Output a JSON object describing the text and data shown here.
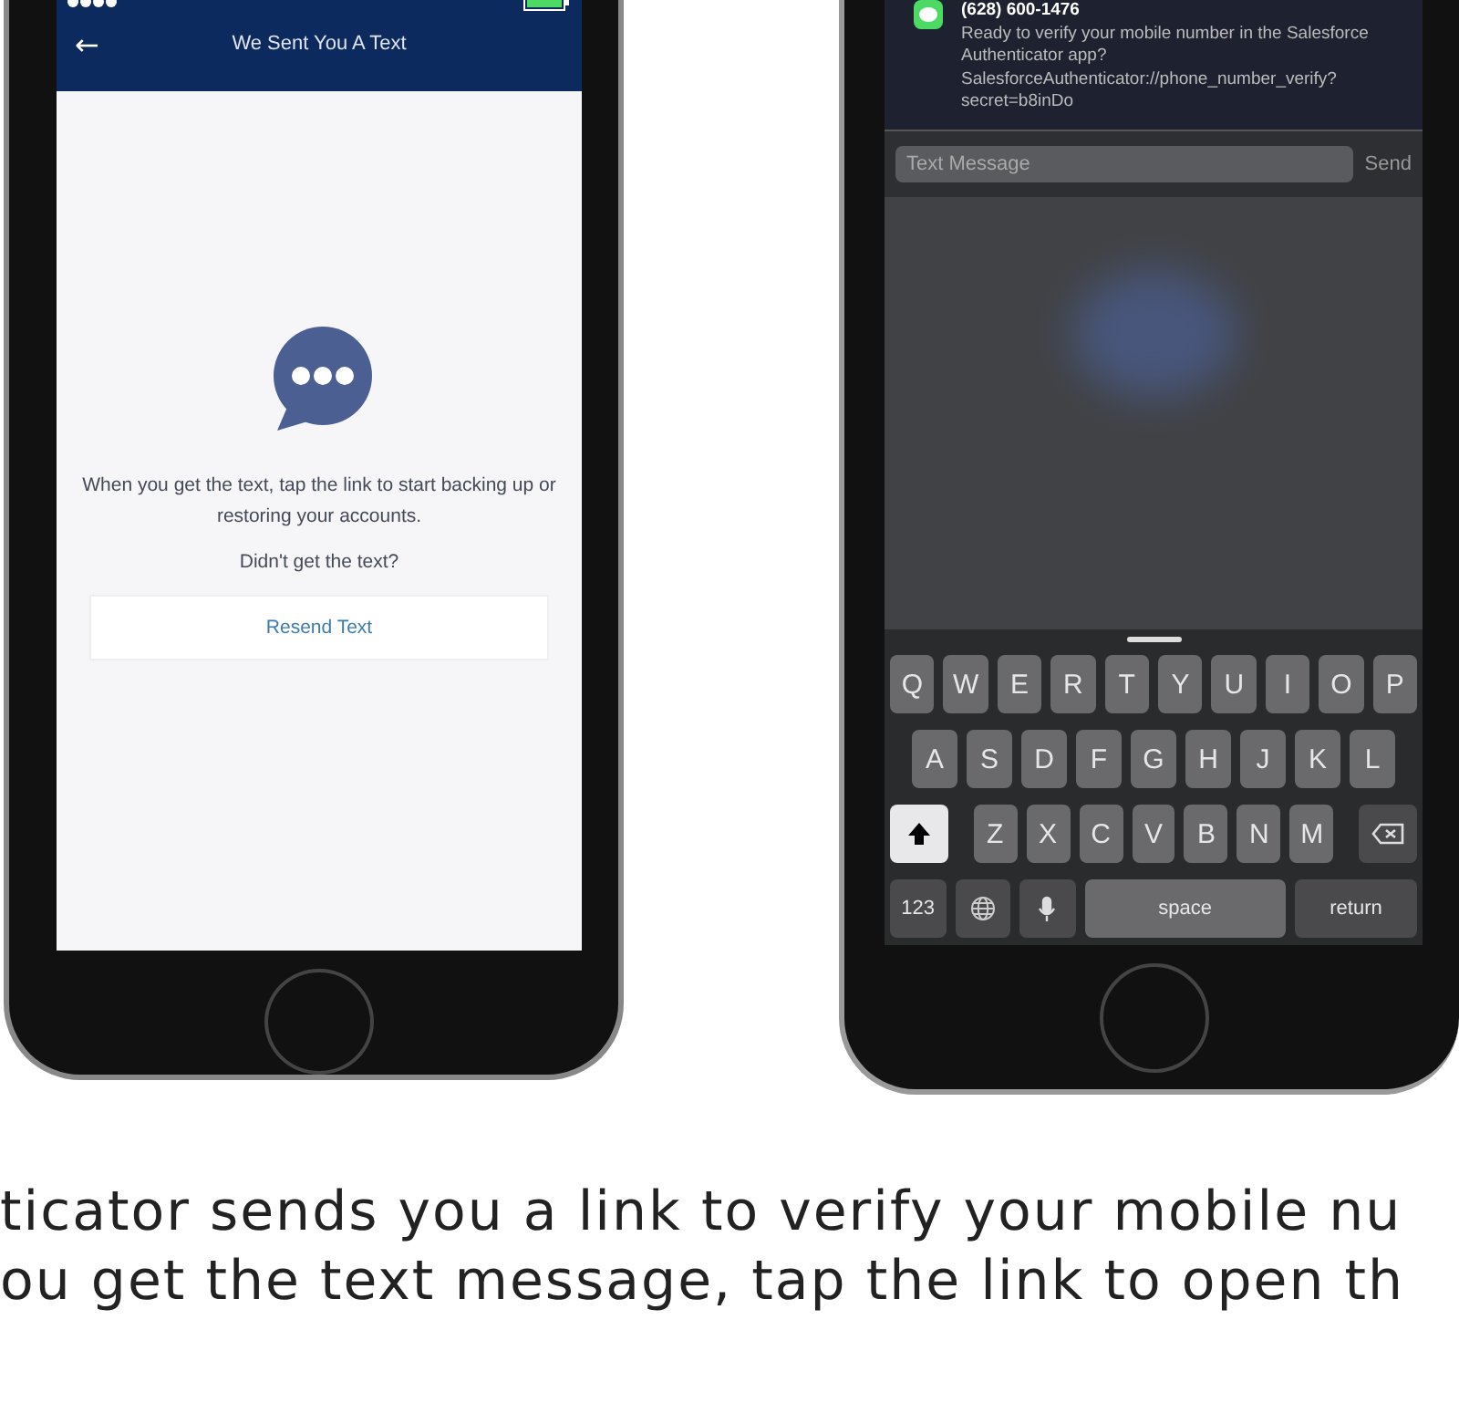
{
  "left_phone": {
    "nav_bar": {
      "back": "←",
      "title": "We Sent You A Text"
    },
    "message": "When you get the text, tap the link to start backing up or restoring your accounts.",
    "prompt": "Didn't get the text?",
    "button": "Resend Text"
  },
  "right_phone": {
    "notification": {
      "sender": "(628) 600-1476",
      "body": "Ready to verify your mobile number in the Salesforce Authenticator app? SalesforceAuthenticator://phone_number_verify?secret=b8inDo"
    },
    "reply": {
      "placeholder": "Text Message",
      "send": "Send"
    },
    "keyboard": [
      [
        {
          "kind": "letter",
          "label": "Q"
        },
        {
          "kind": "letter",
          "label": "W"
        },
        {
          "kind": "letter",
          "label": "E"
        },
        {
          "kind": "letter",
          "label": "R"
        },
        {
          "kind": "letter",
          "label": "T"
        },
        {
          "kind": "letter",
          "label": "Y"
        },
        {
          "kind": "letter",
          "label": "U"
        },
        {
          "kind": "letter",
          "label": "I"
        },
        {
          "kind": "letter",
          "label": "O"
        },
        {
          "kind": "letter",
          "label": "P"
        }
      ],
      [
        {
          "kind": "letter",
          "label": "A"
        },
        {
          "kind": "letter",
          "label": "S"
        },
        {
          "kind": "letter",
          "label": "D"
        },
        {
          "kind": "letter",
          "label": "F"
        },
        {
          "kind": "letter",
          "label": "G"
        },
        {
          "kind": "letter",
          "label": "H"
        },
        {
          "kind": "letter",
          "label": "J"
        },
        {
          "kind": "letter",
          "label": "K"
        },
        {
          "kind": "letter",
          "label": "L"
        }
      ],
      [
        {
          "kind": "shift",
          "on": true
        },
        {
          "kind": "letter",
          "label": "Z"
        },
        {
          "kind": "letter",
          "label": "X"
        },
        {
          "kind": "letter",
          "label": "C"
        },
        {
          "kind": "letter",
          "label": "V"
        },
        {
          "kind": "letter",
          "label": "B"
        },
        {
          "kind": "letter",
          "label": "N"
        },
        {
          "kind": "letter",
          "label": "M"
        },
        {
          "kind": "delete"
        }
      ],
      [
        {
          "kind": "mode",
          "label": "123"
        },
        {
          "kind": "globe"
        },
        {
          "kind": "mic"
        },
        {
          "kind": "space",
          "label": "space"
        },
        {
          "kind": "return",
          "label": "return"
        }
      ]
    ]
  },
  "caption": [
    "ticator sends you a link to verify your mobile nu",
    "ou get the text message, tap the link to open th"
  ]
}
